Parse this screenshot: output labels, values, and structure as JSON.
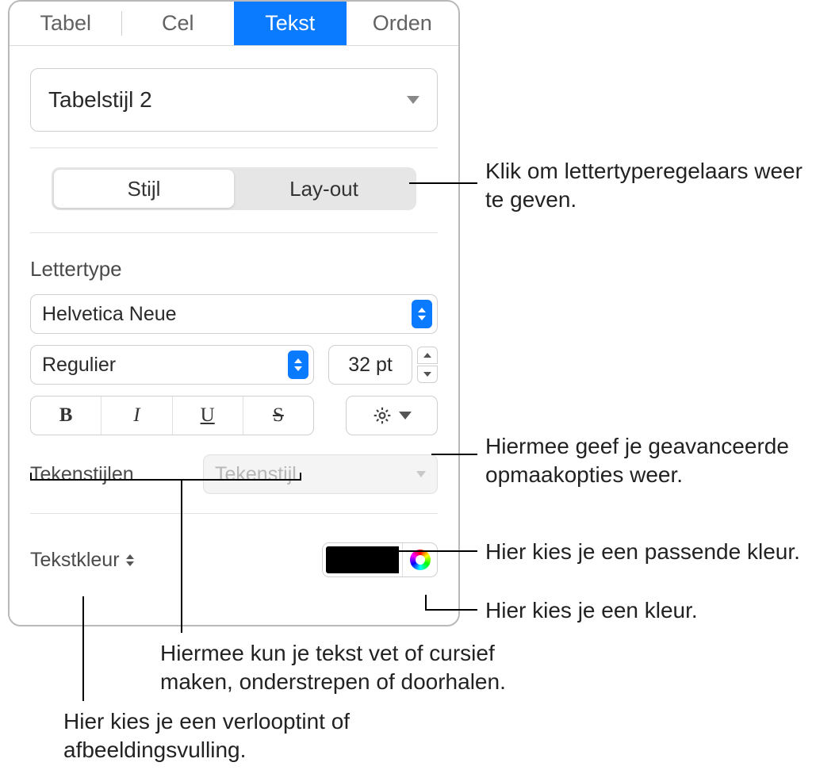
{
  "tabs": {
    "tabel": "Tabel",
    "cel": "Cel",
    "tekst": "Tekst",
    "orden": "Orden"
  },
  "style_name": "Tabelstijl 2",
  "segmented": {
    "stijl": "Stijl",
    "layout": "Lay-out"
  },
  "sections": {
    "lettertype": "Lettertype",
    "tekenstijlen": "Tekenstijlen",
    "tekstkleur": "Tekstkleur"
  },
  "font": {
    "name": "Helvetica Neue",
    "weight": "Regulier",
    "size": "32 pt"
  },
  "bius": {
    "b": "B",
    "i": "I",
    "u": "U",
    "s": "S"
  },
  "char_style_placeholder": "Tekenstijl",
  "colors": {
    "text_color": "#000000"
  },
  "callouts": {
    "segmented": "Klik om lettertyperegelaars weer te geven.",
    "gear": "Hiermee geef je geavanceerde opmaakopties weer.",
    "colorwell": "Hier kies je een passende kleur.",
    "colorwheel": "Hier kies je een kleur.",
    "bius": "Hiermee kun je tekst vet of cursief maken, onderstrepen of doorhalen.",
    "gradient": "Hier kies je een verlooptint of afbeeldingsvulling."
  }
}
